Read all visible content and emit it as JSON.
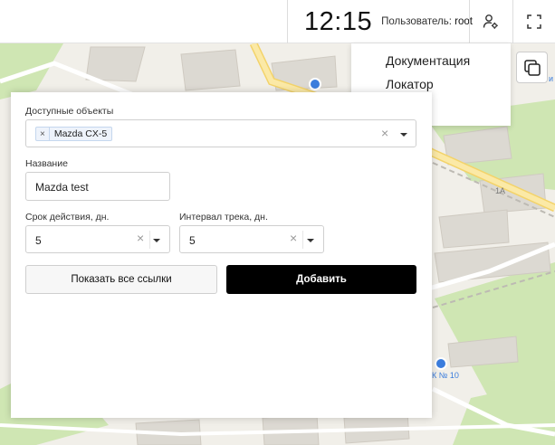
{
  "header": {
    "time": "12:15",
    "user_label": "Пользователь:",
    "user_name": "root"
  },
  "menu": {
    "items": [
      {
        "label": "Документация"
      },
      {
        "label": "Локатор"
      }
    ]
  },
  "map": {
    "labels": [
      "1А",
      "К № 10",
      "и"
    ]
  },
  "form": {
    "objects": {
      "label": "Доступные объекты",
      "selected": [
        {
          "label": "Mazda CX-5",
          "remove": "×"
        }
      ],
      "clear": "×"
    },
    "name": {
      "label": "Название",
      "value": "Mazda test"
    },
    "validity": {
      "label": "Срок действия, дн.",
      "value": "5",
      "clear": "×"
    },
    "interval": {
      "label": "Интервал трека, дн.",
      "value": "5",
      "clear": "×"
    },
    "buttons": {
      "show_links": "Показать все ссылки",
      "add": "Добавить"
    }
  },
  "colors": {
    "map_bg": "#f1efe9",
    "map_green": "#cfe6b3",
    "map_building": "#dcd9d2",
    "map_road_yellow": "#fbe9a6",
    "poi_blue": "#3b7ddd",
    "primary_button": "#000000"
  }
}
